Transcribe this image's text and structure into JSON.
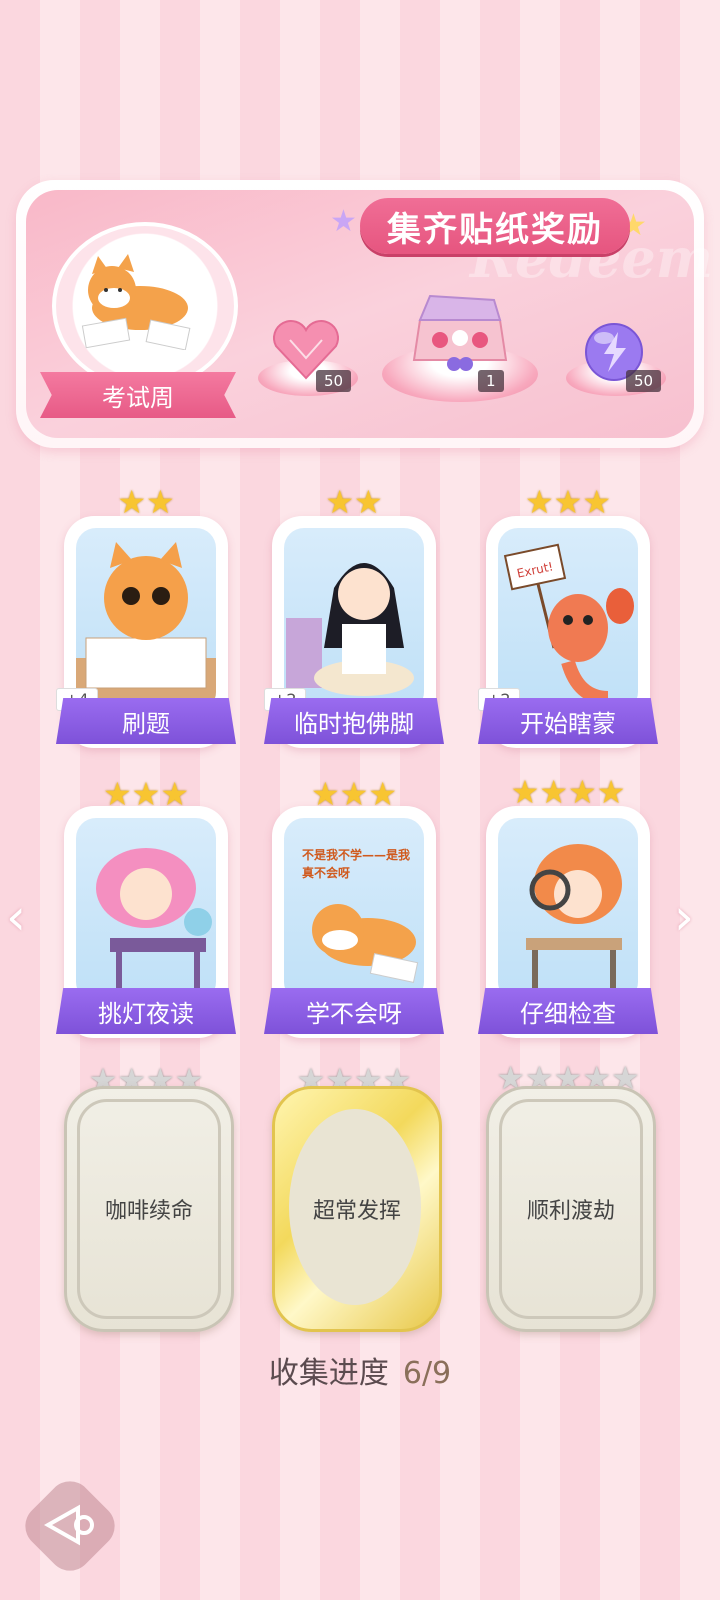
{
  "banner": {
    "title": "集齐贴纸奖励",
    "watermark": "Redeem",
    "event_name": "考试周",
    "rewards": [
      {
        "icon": "heart-gem-icon",
        "count": "50"
      },
      {
        "icon": "gift-box-icon",
        "count": "1"
      },
      {
        "icon": "lightning-orb-icon",
        "count": "50"
      }
    ]
  },
  "cards": [
    {
      "label": "刷题",
      "stars": 2,
      "bonus": "+4",
      "collected": true
    },
    {
      "label": "临时抱佛脚",
      "stars": 2,
      "bonus": "+2",
      "collected": true
    },
    {
      "label": "开始瞎蒙",
      "stars": 3,
      "bonus": "+2",
      "collected": true,
      "sign": "Exrut!"
    },
    {
      "label": "挑灯夜读",
      "stars": 3,
      "collected": true
    },
    {
      "label": "学不会呀",
      "stars": 3,
      "collected": true,
      "caption": "不是我不学——是我真不会呀"
    },
    {
      "label": "仔细检查",
      "stars": 4,
      "collected": true
    },
    {
      "label": "咖啡续命",
      "stars": 4,
      "collected": false
    },
    {
      "label": "超常发挥",
      "stars": 4,
      "collected": false
    },
    {
      "label": "顺利渡劫",
      "stars": 5,
      "collected": false
    }
  ],
  "progress": {
    "label": "收集进度",
    "value": "6/9"
  },
  "colors": {
    "pink": "#f06e96",
    "purple": "#8a5ce4",
    "gold": "#f8c531"
  }
}
